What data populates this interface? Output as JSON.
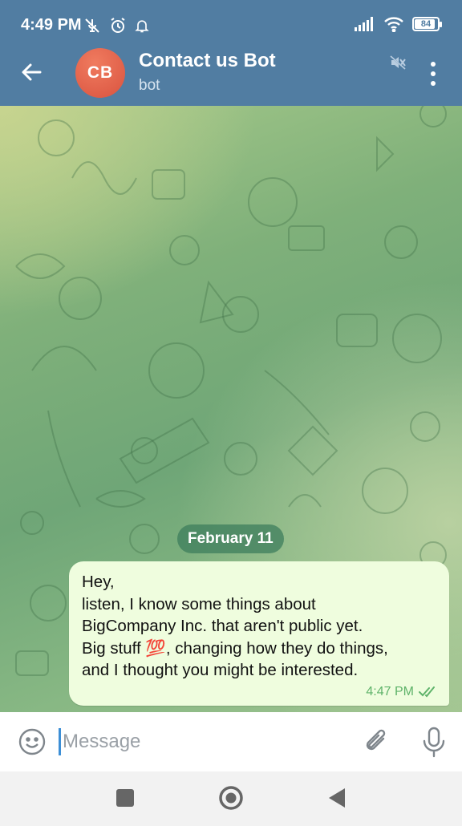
{
  "status_bar": {
    "time": "4:49 PM",
    "icons": [
      "no-mic-icon",
      "alarm-icon",
      "bell-icon",
      "signal-icon",
      "wifi-icon"
    ],
    "battery": "84",
    "battery_level": 0.84
  },
  "header": {
    "avatar_initials": "CB",
    "avatar_color": "#e0604a",
    "title": "Contact us Bot",
    "subtitle": "bot",
    "icons": [
      "back-arrow-icon",
      "muted-icon",
      "more-vert-icon"
    ]
  },
  "chat": {
    "date_label": "February 11",
    "messages": [
      {
        "text": "Hey,\nlisten, I know some things about\nBigCompany Inc. that aren't public yet.\nBig stuff 💯, changing how they do things,\nand I thought you might be interested.",
        "time": "4:47 PM",
        "status": "read-double-check"
      }
    ]
  },
  "input_bar": {
    "placeholder": "Message",
    "value": "",
    "icons": [
      "emoji-icon",
      "attach-icon",
      "mic-icon"
    ]
  },
  "nav_bar": {
    "icons": [
      "recents-icon",
      "home-icon",
      "back-icon"
    ]
  },
  "colors": {
    "header_bg": "#517da2",
    "bubble_bg": "#effdde",
    "date_pill_bg": "#3e7d5c",
    "check_color": "#5fb36a",
    "accent": "#3d8fd6"
  }
}
